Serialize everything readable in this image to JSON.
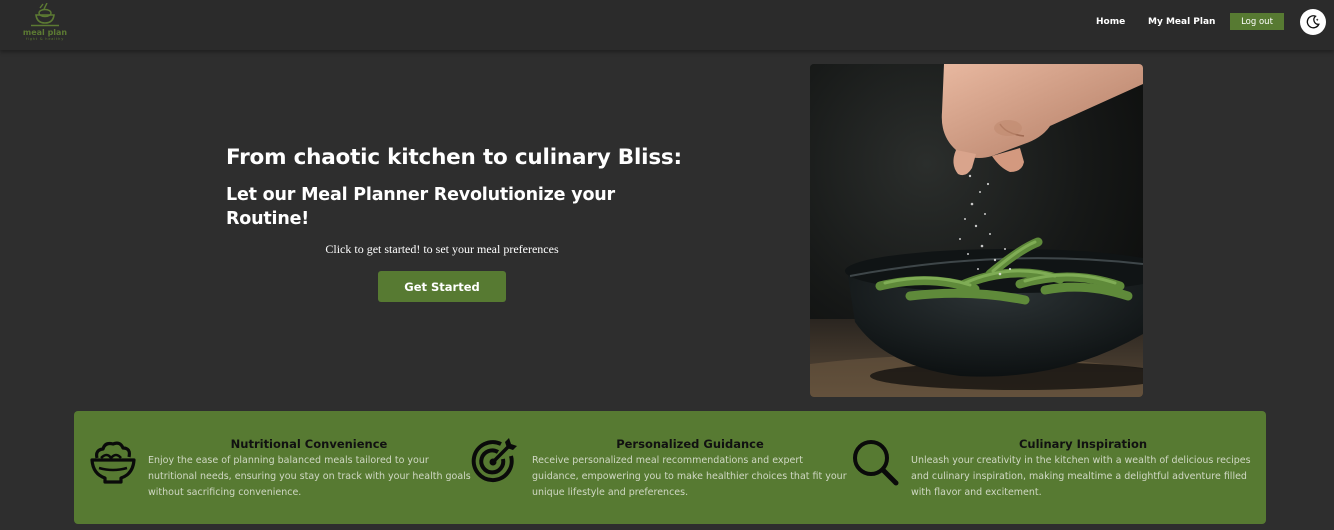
{
  "brand": {
    "name": "meal plan",
    "tagline": "fight & healthy",
    "accent": "#577a32",
    "background": "#2e2e2e",
    "navbar_background": "#2b2b2b"
  },
  "nav": {
    "links": [
      {
        "label": "Home"
      },
      {
        "label": "My Meal Plan"
      }
    ],
    "logout_label": "Log out",
    "theme_toggle_icon": "moon-icon"
  },
  "hero": {
    "heading": "From chaotic kitchen to culinary Bliss:",
    "subheading": "Let our Meal Planner Revolutionize your Routine!",
    "caption": "Click to get started! to set your meal preferences",
    "cta_label": "Get Started",
    "image_icon": "salt-sprinkling-over-edamame-bowl-photo"
  },
  "features": [
    {
      "icon": "salad-bowl-icon",
      "title": "Nutritional Convenience",
      "description": "Enjoy the ease of planning balanced meals tailored to your nutritional needs, ensuring you stay on track with your health goals without sacrificing convenience."
    },
    {
      "icon": "target-icon",
      "title": "Personalized Guidance",
      "description": "Receive personalized meal recommendations and expert guidance, empowering you to make healthier choices that fit your unique lifestyle and preferences."
    },
    {
      "icon": "search-icon",
      "title": "Culinary Inspiration",
      "description": "Unleash your creativity in the kitchen with a wealth of delicious recipes and culinary inspiration, making mealtime a delightful adventure filled with flavor and excitement."
    }
  ]
}
